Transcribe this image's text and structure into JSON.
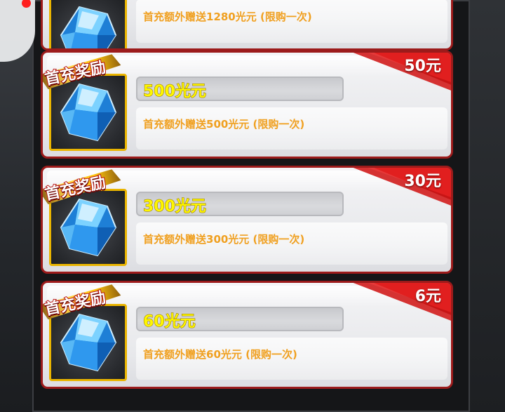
{
  "colors": {
    "card_border": "#9c1b1b",
    "ribbon_red": "#c71515",
    "gold": "#e9b400",
    "name_yellow": "#fff700",
    "desc_orange": "#f0a020"
  },
  "badge_label": "首充奖励",
  "items": [
    {
      "name": "",
      "price": "",
      "description": "首充额外赠送1280光元 (限购一次)",
      "icon": "blue-crystal-icon"
    },
    {
      "name": "500光元",
      "price": "50元",
      "description": "首充额外赠送500光元 (限购一次)",
      "icon": "blue-crystal-icon"
    },
    {
      "name": "300光元",
      "price": "30元",
      "description": "首充额外赠送300光元 (限购一次)",
      "icon": "blue-crystal-icon"
    },
    {
      "name": "60光元",
      "price": "6元",
      "description": "首充额外赠送60光元 (限购一次)",
      "icon": "blue-crystal-icon"
    }
  ],
  "side_button_icon": "side-menu-icon"
}
